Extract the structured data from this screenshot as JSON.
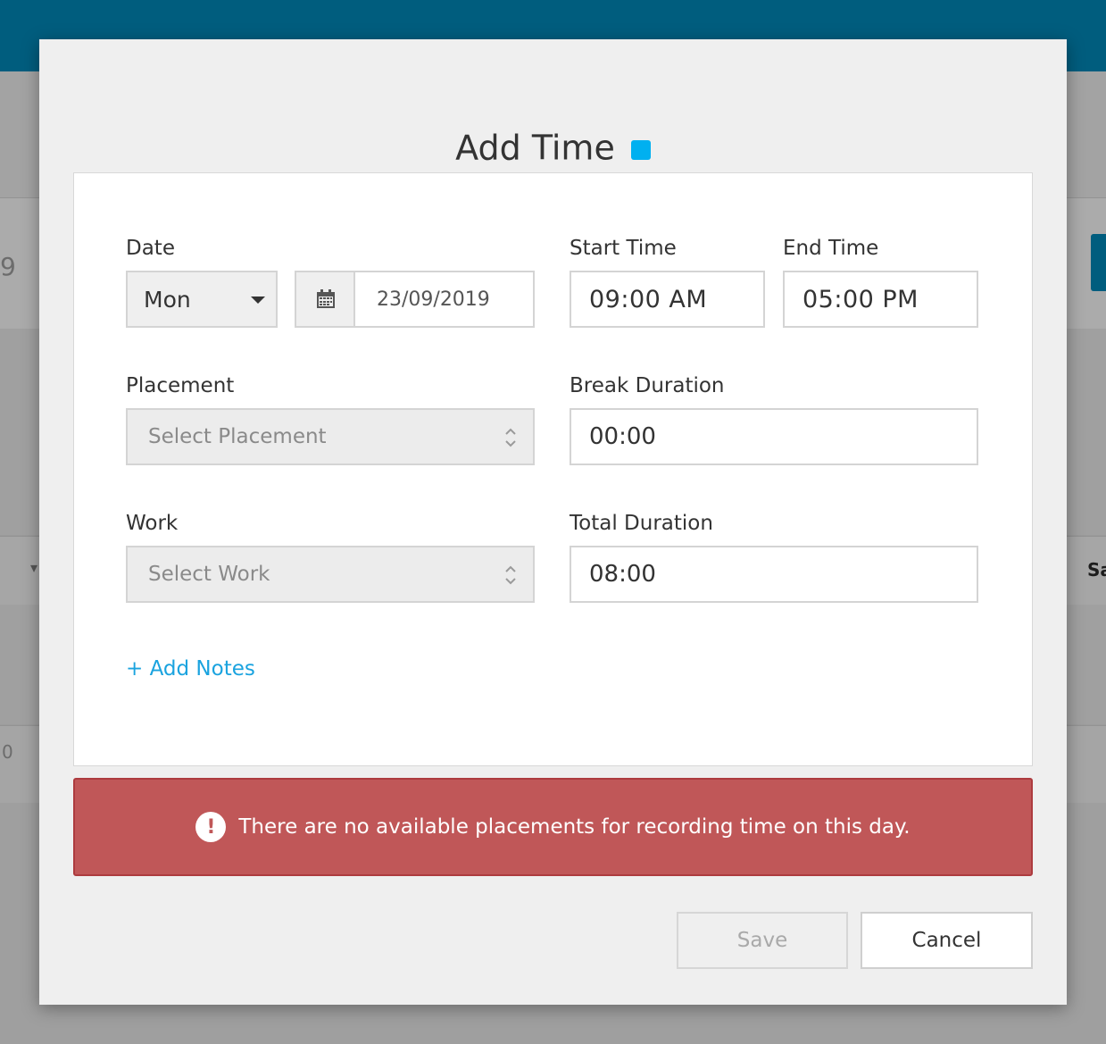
{
  "background": {
    "fragment_left": "9",
    "fragment_left_lower": "0",
    "fragment_right": "Sa"
  },
  "modal": {
    "title": "Add Time",
    "accent_color": "#00b0f0",
    "form": {
      "date": {
        "label": "Date",
        "day_value": "Mon",
        "date_value": "23/09/2019"
      },
      "start_time": {
        "label": "Start Time",
        "value": "09:00 AM"
      },
      "end_time": {
        "label": "End Time",
        "value": "05:00 PM"
      },
      "placement": {
        "label": "Placement",
        "placeholder": "Select Placement"
      },
      "break_duration": {
        "label": "Break Duration",
        "value": "00:00"
      },
      "work": {
        "label": "Work",
        "placeholder": "Select Work"
      },
      "total_duration": {
        "label": "Total Duration",
        "value": "08:00"
      },
      "add_notes_label": "+ Add Notes"
    },
    "alert": {
      "message": "There are no available placements for recording time on this day.",
      "icon": "exclamation-circle-icon",
      "color": "#c05758"
    },
    "buttons": {
      "save_label": "Save",
      "cancel_label": "Cancel"
    }
  }
}
